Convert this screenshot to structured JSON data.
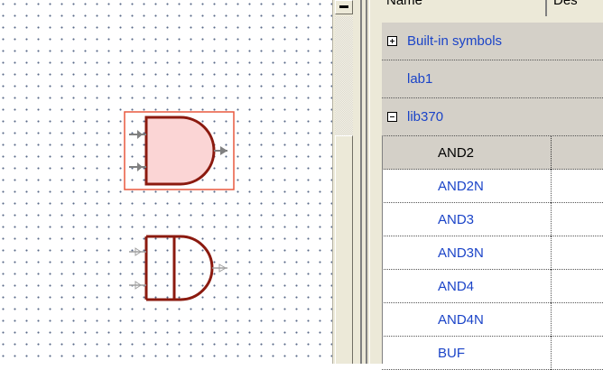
{
  "list": {
    "columns": [
      "Name",
      "Des"
    ],
    "groups": [
      {
        "label": "Built-in symbols",
        "toggle": "+"
      },
      {
        "label": "lab1",
        "toggle": ""
      },
      {
        "label": "lib370",
        "toggle": "-"
      }
    ],
    "items": [
      "AND2",
      "AND2N",
      "AND3",
      "AND3N",
      "AND4",
      "AND4N",
      "BUF"
    ],
    "selected_item": "AND2"
  },
  "colors": {
    "link_text": "#1b44c8",
    "gate_outline": "#8b1a0f",
    "gate_fill_selected": "#fbd5d5",
    "selection_box": "#e8593f",
    "pin": "#808080"
  }
}
